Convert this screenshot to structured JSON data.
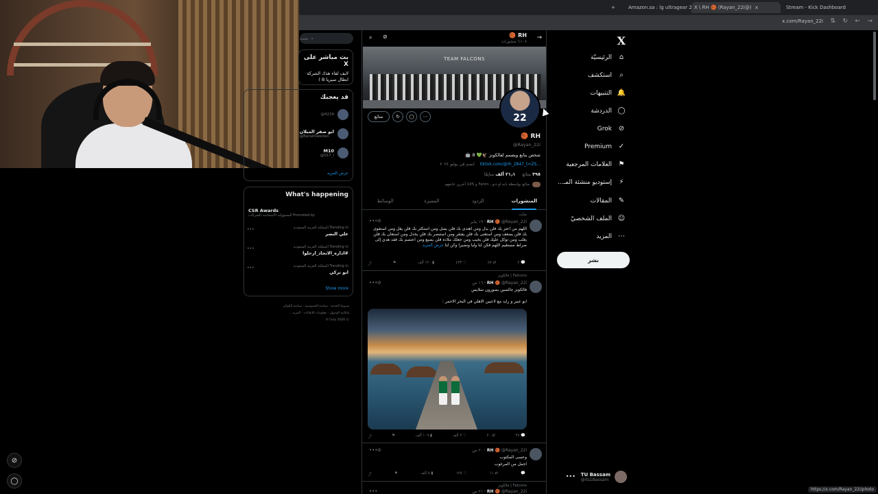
{
  "browser": {
    "tabs": [
      {
        "label": "Amazon.sa : lg ultragear 27",
        "active": false
      },
      {
        "label": "X \\ RH 🏀 (Rayan_22i@)",
        "active": true
      },
      {
        "label": "Stream - Kick Dashboard",
        "active": false
      }
    ],
    "url": "x.com/Rayan_22i",
    "status_url": "https://x.com/Rayan_22i/photo"
  },
  "leftnav": {
    "logo": "X",
    "items": [
      {
        "label": "الرئيسيّة",
        "icon": "⌂"
      },
      {
        "label": "استكشف",
        "icon": "⌕"
      },
      {
        "label": "التنبيهات",
        "icon": "🔔"
      },
      {
        "label": "الدردشة",
        "icon": "◯"
      },
      {
        "label": "Grok",
        "icon": "⊘"
      },
      {
        "label": "Premium",
        "icon": "✓"
      },
      {
        "label": "العلامات المرجعية",
        "icon": "⚑"
      },
      {
        "label": "إستوديو منشئة المـ...",
        "icon": "⚡"
      },
      {
        "label": "المقالات",
        "icon": "✎"
      },
      {
        "label": "الملف الشخصيّ",
        "icon": "☺"
      },
      {
        "label": "المزيد",
        "icon": "⋯"
      }
    ],
    "post_button": "نشر",
    "account": {
      "name": "TU Bassam",
      "handle": "@its1Bassam"
    }
  },
  "profile": {
    "header_name": "RH 🏀",
    "header_count": "٦٫١٠٨ منشورات",
    "banner_text": "TEAM FALCONS",
    "avatar_number": "22",
    "follow_button": "متابَع",
    "name": "RH 🏀",
    "handle": "@Rayan_22i",
    "bio": "شخص يتابع ويصمم لفالكونز 🦅💚 8 🤖",
    "link": "tiktok.com/@rh_2847_t=ZS...",
    "joined": "انضم في يوليو ٢٠٢٤",
    "following_count": "٣٩٥",
    "following_label": "متابَع",
    "followers_count": "٢١٫١ ألف",
    "followers_label": "متابِعًا",
    "followed_by": "متابَع بواسطة بابه او دنو ، Fahm و 105 آخرين تتابعهم",
    "tabs": [
      "المنشورات",
      "الردود",
      "المميزة",
      "الوسائط"
    ]
  },
  "tweets": [
    {
      "context": "مثبّت",
      "name": "RH 🏀",
      "handle": "@Rayan_22i",
      "time": "١٩ يناير",
      "body": "اللهم من اعتز بك فلن يذل ومن اهتدى بك فلن يضل ومن استكثر بك فلن يقل ومن استقوى بك فلن يضعف ومن استغنى بك فلن يفتقر ومن استنصر بك فلن يخذل ومن استعان بك فلن يغلب ومن توكل عليك فلن يخيب ومن جعلك ملاذه فلن يضيع ومن اعتصم بك فقد هدي إلى صراط مستقيم اللهم فكن لنا وليا ونصيرا وكن لنا",
      "more": "عرض المزيد",
      "replies": "٢",
      "reposts": "٥٧",
      "likes": "٤٢٣",
      "views": "١٢٠ ألف"
    },
    {
      "context": "Falcons | فالكونز",
      "name": "RH 🏀",
      "handle": "@Rayan_22i",
      "time": "١٦ س",
      "line1": "فالكونز جالسين يصورون سلايس",
      "line2": "ابو عبير و رايد مع لاعبين الاهلي في البحر الاحمر :",
      "replies": "٢٩",
      "reposts": "٢٠",
      "likes": "٢ آلف",
      "views": "١٠٩ آلف"
    },
    {
      "name": "RH 🏀",
      "handle": "@Rayan_22i",
      "time": "٢٠ س",
      "line1": "وعسى المكتوب",
      "line2": "اجمل من المرغوب",
      "replies": "١١",
      "reposts": "",
      "likes": "١٢٥",
      "views": "٥ آلف"
    },
    {
      "context": "Falcons | فالكونز",
      "name": "RH 🏀",
      "handle": "@Rayan_22i",
      "time": "٢١ س"
    }
  ],
  "right": {
    "search_placeholder": "بحث",
    "live": {
      "title": "بث مباشر على X",
      "text": "لايف لقاء هذك الشركة ابطال سيريا B )"
    },
    "who": {
      "title": "قد يعجبك",
      "people": [
        {
          "name": "",
          "handle": "@4224"
        },
        {
          "name": "ابو صقر الميلان",
          "handle": "@BarakSwedan"
        },
        {
          "name": "M10",
          "handle": "@017_l"
        }
      ],
      "more": "عرض المزيد"
    },
    "happening": {
      "title": "What's happening",
      "promo_title": "CSR Awards",
      "promo_meta": "المسؤولية الاجتماعية للشركات Promoted by",
      "trends": [
        {
          "meta": "Trending in المملكة العربية السعودية",
          "name": "علي النصر"
        },
        {
          "meta": "Trending in المملكة العربية السعودية",
          "name": "#اداره_الاتحاد_ارحلوا"
        },
        {
          "meta": "Trending in المملكة العربية السعودية",
          "name": "ابو تركي"
        }
      ],
      "show_more": "Show more"
    },
    "footer": [
      "شروط الخدمة",
      "سياسة الخصوصية",
      "سياسة الكوكيز",
      "إمكانية الوصول",
      "معلومات الإعلانات",
      "المزيد...",
      "© 2026 X Corp."
    ]
  }
}
